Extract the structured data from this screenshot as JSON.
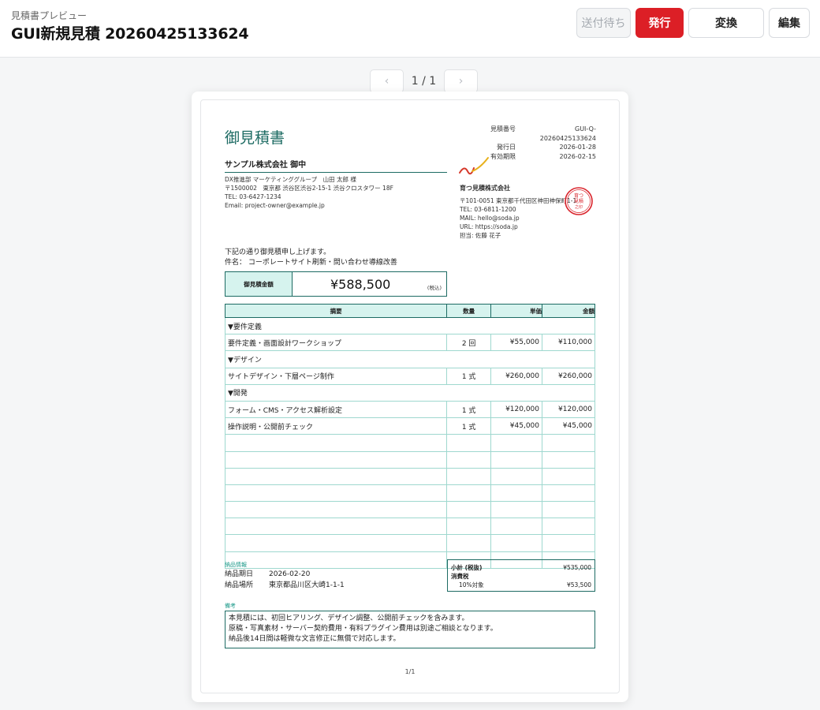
{
  "header": {
    "breadcrumb": "見積書プレビュー",
    "title": "GUI新規見積 20260425133624",
    "buttons": {
      "pending": "送付待ち",
      "issue": "発行",
      "convert": "変換",
      "edit": "編集"
    },
    "accent_color": "#dc1f26"
  },
  "pager": {
    "prev_icon": "chevron-left-icon",
    "next_icon": "chevron-right-icon",
    "text": "1 / 1"
  },
  "document": {
    "title": "御見積書",
    "theme_color": "#1d6b63",
    "meta": [
      {
        "label": "見積番号",
        "value": "GUI-Q-20260425133624"
      },
      {
        "label": "発行日",
        "value": "2026-01-28"
      },
      {
        "label": "有効期限",
        "value": "2026-02-15"
      }
    ],
    "client": {
      "name": "サンプル株式会社 御中",
      "lines": [
        "DX推進部 マーケティンググループ　山田 太郎 様",
        "〒1500002　東京都 渋谷区渋谷2-15-1 渋谷クロスタワー 18F",
        "TEL: 03-6427-1234",
        "Email: project-owner@example.jp"
      ]
    },
    "issuer": {
      "name": "育つ見積株式会社",
      "lines": [
        "〒101-0051 東京都千代田区神田神保町1-1",
        "TEL: 03-6811-1200",
        "MAIL: hello@soda.jp",
        "URL: https://soda.jp",
        "担当: 佐藤 花子"
      ],
      "seal_text": "育つ見積之印"
    },
    "intro": "下記の通り御見積申し上げます。",
    "subject": "件名：  コーポレートサイト刷新・問い合わせ導線改善",
    "total": {
      "label": "御見積金額",
      "amount": "¥588,500",
      "tax_note": "(税込)"
    },
    "table": {
      "headers": {
        "desc": "摘要",
        "qty": "数量",
        "unit": "単価",
        "amount": "金額"
      },
      "rows": [
        {
          "section": "▼要件定義"
        },
        {
          "desc": "要件定義・画面設計ワークショップ",
          "qty": "2 回",
          "unit": "¥55,000",
          "amount": "¥110,000"
        },
        {
          "section": "▼デザイン"
        },
        {
          "desc": "サイトデザイン・下層ページ制作",
          "qty": "1 式",
          "unit": "¥260,000",
          "amount": "¥260,000"
        },
        {
          "section": "▼開発"
        },
        {
          "desc": "フォーム・CMS・アクセス解析設定",
          "qty": "1 式",
          "unit": "¥120,000",
          "amount": "¥120,000"
        },
        {
          "desc": "操作説明・公開前チェック",
          "qty": "1 式",
          "unit": "¥45,000",
          "amount": "¥45,000"
        },
        {
          "desc": "",
          "qty": "",
          "unit": "",
          "amount": ""
        },
        {
          "desc": "",
          "qty": "",
          "unit": "",
          "amount": ""
        },
        {
          "desc": "",
          "qty": "",
          "unit": "",
          "amount": ""
        },
        {
          "desc": "",
          "qty": "",
          "unit": "",
          "amount": ""
        },
        {
          "desc": "",
          "qty": "",
          "unit": "",
          "amount": ""
        },
        {
          "desc": "",
          "qty": "",
          "unit": "",
          "amount": ""
        },
        {
          "desc": "",
          "qty": "",
          "unit": "",
          "amount": ""
        },
        {
          "desc": "",
          "qty": "",
          "unit": "",
          "amount": ""
        }
      ]
    },
    "delivery": {
      "label": "納品情報",
      "date_label": "納品期日",
      "date_value": "2026-02-20",
      "place_label": "納品場所",
      "place_value": "東京都品川区大崎1-1-1"
    },
    "summary": {
      "subtotal_label": "小計 (税抜)",
      "subtotal_value": "¥535,000",
      "tax_label": "消費税",
      "tax_rate_label": "10%対象",
      "tax_value": "¥53,500"
    },
    "notes": {
      "label": "備考",
      "lines": [
        "本見積には、初回ヒアリング、デザイン調整、公開前チェックを含みます。",
        "原稿・写真素材・サーバー契約費用・有料プラグイン費用は別途ご相談となります。",
        "納品後14日間は軽微な文言修正に無償で対応します。"
      ]
    },
    "page_footer": "1/1"
  }
}
